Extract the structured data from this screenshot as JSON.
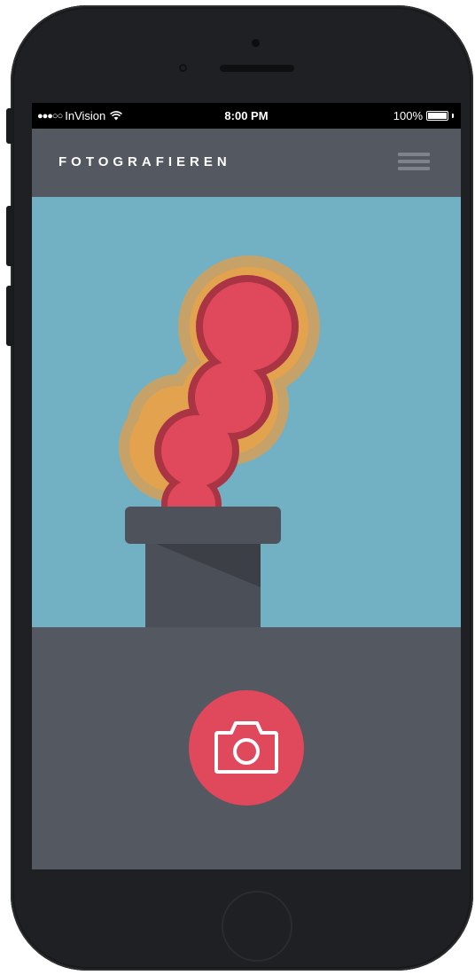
{
  "status_bar": {
    "signal": "●●●○○",
    "carrier": "InVision",
    "time": "8:00 PM",
    "battery": "100%"
  },
  "header": {
    "title": "FOTOGRAFIEREN",
    "menu_icon": "hamburger-menu-icon"
  },
  "illustration": {
    "icon": "chimney-smoke-illustration"
  },
  "shutter": {
    "icon": "camera-icon"
  },
  "colors": {
    "sky": "#72b1c4",
    "ground": "#545861",
    "chimney": "#4b4f57",
    "smoke_red": "#e0485c",
    "smoke_outline": "#a93444",
    "glow_orange": "#e3a24d",
    "glow_tan": "#c6a268",
    "shutter_button": "#e0485c"
  }
}
